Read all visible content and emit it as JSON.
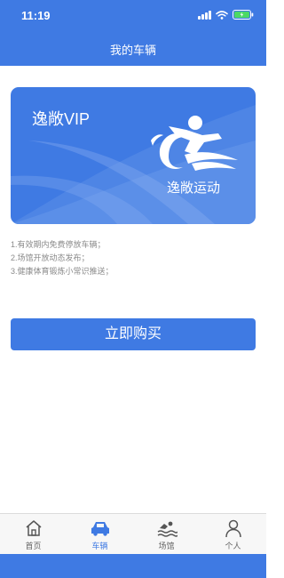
{
  "status_bar": {
    "time": "11:19"
  },
  "header": {
    "title": "我的车辆"
  },
  "vip_card": {
    "title": "逸敞VIP",
    "brand": "逸敞运动",
    "color": "#3f7ae3"
  },
  "benefits": [
    "1.有效期内免费停放车辆；",
    "2.场馆开放动态发布；",
    "3.健康体育锻炼小常识推送；"
  ],
  "buy_button": {
    "label": "立即购买"
  },
  "tabbar": {
    "active_color": "#3f7ae3",
    "items": [
      {
        "label": "首页",
        "icon": "home-icon"
      },
      {
        "label": "车辆",
        "icon": "car-icon",
        "active": true
      },
      {
        "label": "场馆",
        "icon": "swim-icon"
      },
      {
        "label": "个人",
        "icon": "person-icon"
      }
    ]
  }
}
